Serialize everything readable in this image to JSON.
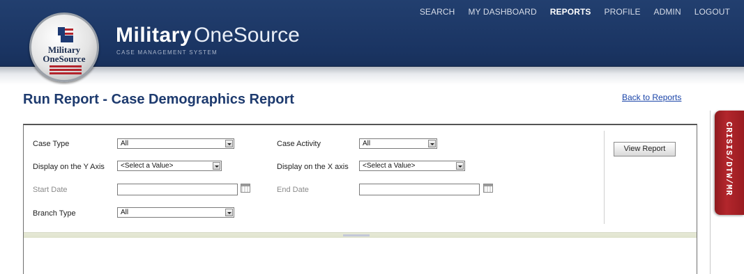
{
  "header": {
    "seal_line1": "Military",
    "seal_line2": "OneSource",
    "brand_bold": "Military",
    "brand_light": "OneSource",
    "brand_sub": "CASE MANAGEMENT SYSTEM",
    "nav": [
      {
        "label": "SEARCH",
        "active": false
      },
      {
        "label": "MY DASHBOARD",
        "active": false
      },
      {
        "label": "REPORTS",
        "active": true
      },
      {
        "label": "PROFILE",
        "active": false
      },
      {
        "label": "ADMIN",
        "active": false
      },
      {
        "label": "LOGOUT",
        "active": false
      }
    ]
  },
  "page": {
    "title": "Run Report - Case Demographics Report",
    "back_link": "Back to Reports",
    "side_tab": "CRISIS/DTW/MR"
  },
  "form": {
    "case_type_label": "Case Type",
    "case_type_value": "All",
    "case_activity_label": "Case Activity",
    "case_activity_value": "All",
    "y_axis_label": "Display on the Y Axis",
    "y_axis_value": "<Select a Value>",
    "x_axis_label": "Display on the X axis",
    "x_axis_value": "<Select a Value>",
    "start_date_label": "Start Date",
    "start_date_value": "",
    "end_date_label": "End Date",
    "end_date_value": "",
    "branch_type_label": "Branch Type",
    "branch_type_value": "All",
    "view_report_label": "View Report"
  },
  "colors": {
    "header_bg": "#1a3462",
    "title": "#1d3a6e",
    "link": "#1a44a8",
    "side_tab": "#b3262c"
  }
}
